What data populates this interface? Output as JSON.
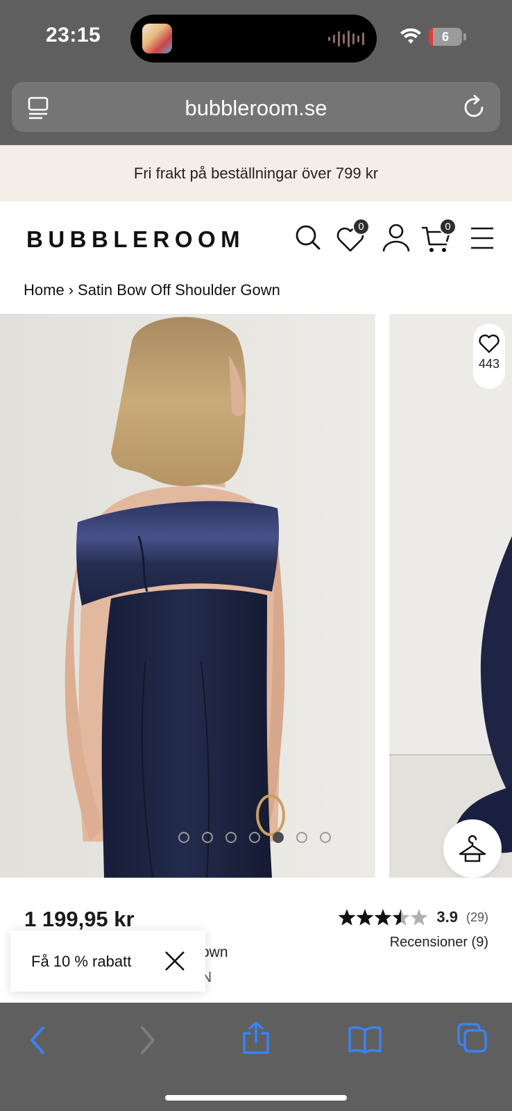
{
  "status_bar": {
    "time": "23:15",
    "battery_level": "6",
    "icons": [
      "app-activity-icon",
      "audio-wave-icon",
      "wifi-icon",
      "battery-icon"
    ]
  },
  "browser": {
    "url": "bubbleroom.se",
    "icons": [
      "tabs-overview-icon",
      "reload-icon"
    ]
  },
  "promo": {
    "text": "Fri frakt på beställningar över 799 kr"
  },
  "header": {
    "logo": "BUBBLEROOM",
    "wishlist_count": "0",
    "cart_count": "0",
    "icons": [
      "search-icon",
      "heart-icon",
      "user-icon",
      "cart-icon",
      "menu-icon"
    ]
  },
  "breadcrumb": {
    "home": "Home",
    "separator": "›",
    "current": "Satin Bow Off Shoulder Gown"
  },
  "gallery": {
    "wishlist_count": "443",
    "dot_count": 7,
    "active_dot": 5,
    "icons": [
      "heart-outline-icon",
      "hanger-icon"
    ]
  },
  "product": {
    "price": "1 199,95 kr",
    "name_fragment": "own",
    "brand_fragment": "N",
    "rating": "3.9",
    "rating_count": "(29)",
    "rating_fraction": 0.78,
    "reviews_label": "Recensioner (9)"
  },
  "discount_popup": {
    "text": "Få 10 % rabatt",
    "icons": [
      "close-icon"
    ]
  },
  "toolbar": {
    "icons": [
      "back-icon",
      "forward-icon",
      "share-icon",
      "bookmarks-icon",
      "tabs-icon"
    ],
    "accent": "#3b82f6"
  },
  "colors": {
    "chrome_bg": "#5f5f5f",
    "promo_bg": "#f5ede8",
    "dress_navy": "#1f2746"
  }
}
